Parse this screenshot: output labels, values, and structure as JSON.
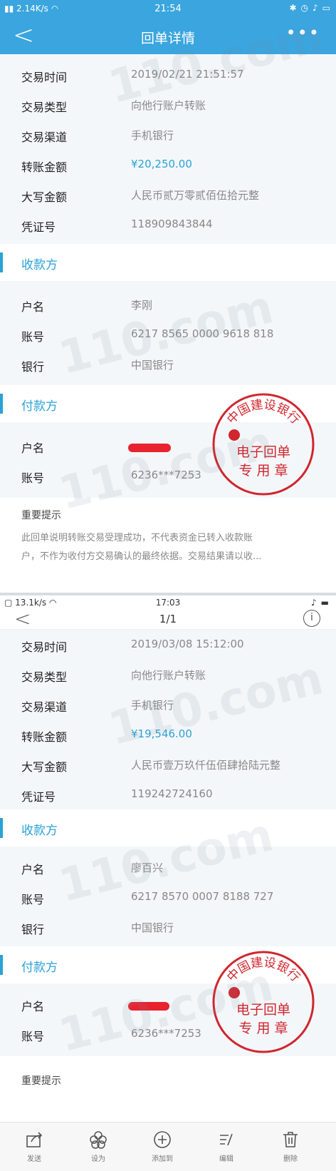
{
  "screen1": {
    "status": {
      "left": "2.14K/s",
      "time": "21:54"
    },
    "nav": {
      "back": "<",
      "title": "回单详情",
      "more": "•••"
    },
    "details": [
      {
        "label": "交易时间",
        "value": "2019/02/21  21:51:57"
      },
      {
        "label": "交易类型",
        "value": "向他行账户转账"
      },
      {
        "label": "交易渠道",
        "value": "手机银行"
      },
      {
        "label": "转账金额",
        "value": "¥20,250.00"
      },
      {
        "label": "大写金额",
        "value": "人民币贰万零贰佰伍拾元整"
      },
      {
        "label": "凭证号",
        "value": "118909843844"
      }
    ],
    "payee_title": "收款方",
    "payee": [
      {
        "label": "户名",
        "value": "李刚"
      },
      {
        "label": "账号",
        "value": "6217 8565 0000 9618 818"
      },
      {
        "label": "银行",
        "value": "中国银行"
      }
    ],
    "payer_title": "付款方",
    "payer": [
      {
        "label": "户名",
        "value": ""
      },
      {
        "label": "账号",
        "value": "6236***7253"
      }
    ],
    "notice_title": "重要提示",
    "notice_line1": "此回单说明转账交易受理成功，不代表资金已转入收款账",
    "notice_line2": "户，不作为收付方交易确认的最终依据。交易结果请以收..."
  },
  "screen2": {
    "status": {
      "left": "13.1k/s",
      "time": "17:03"
    },
    "nav": {
      "back": "<",
      "title": "1/1",
      "info": "i"
    },
    "details": [
      {
        "label": "交易时间",
        "value": "2019/03/08  15:12:00"
      },
      {
        "label": "交易类型",
        "value": "向他行账户转账"
      },
      {
        "label": "交易渠道",
        "value": "手机银行"
      },
      {
        "label": "转账金额",
        "value": "¥19,546.00"
      },
      {
        "label": "大写金额",
        "value": "人民币壹万玖仟伍佰肆拾陆元整"
      },
      {
        "label": "凭证号",
        "value": "119242724160"
      }
    ],
    "payee_title": "收款方",
    "payee": [
      {
        "label": "户名",
        "value": "廖百兴"
      },
      {
        "label": "账号",
        "value": "6217 8570 0007 8188 727"
      },
      {
        "label": "银行",
        "value": "中国银行"
      }
    ],
    "payer_title": "付款方",
    "payer": [
      {
        "label": "户名",
        "value": ""
      },
      {
        "label": "账号",
        "value": "6236***7253"
      }
    ],
    "notice_title": "重要提示"
  },
  "stamp": {
    "bank_name": "中国建设银行",
    "line1": "电子回单",
    "line2": "专 用 章",
    "color": "#d0262e"
  },
  "toolbar": [
    {
      "label": "发送",
      "icon": "share-icon"
    },
    {
      "label": "设为",
      "icon": "flower-icon"
    },
    {
      "label": "添加到",
      "icon": "add-circle-icon"
    },
    {
      "label": "编辑",
      "icon": "edit-icon"
    },
    {
      "label": "删除",
      "icon": "trash-icon"
    }
  ],
  "watermark": "110.com",
  "colors": {
    "header": "#3aa5de",
    "accent": "#2aa2d6",
    "stamp": "#d0262e"
  }
}
